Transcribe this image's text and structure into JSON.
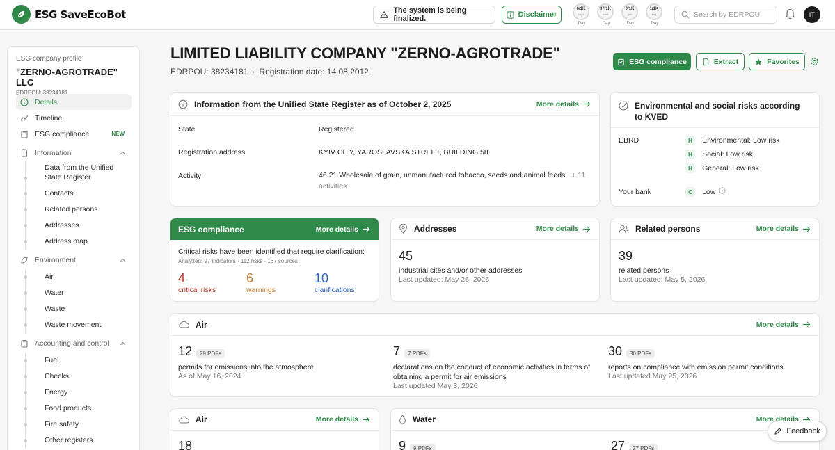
{
  "header": {
    "brand": "ESG SaveEcoBot",
    "system_notice": "The system is being finalized.",
    "disclaimer": "Disclaimer",
    "quotas": [
      {
        "value": "6/1K",
        "sub": "high",
        "label": "Day"
      },
      {
        "value": "37/1K",
        "sub": "med",
        "label": "Day"
      },
      {
        "value": "0/1K",
        "sub": "gen",
        "label": "Day"
      },
      {
        "value": "1/1K",
        "sub": "esg",
        "label": "Day"
      }
    ],
    "search_placeholder": "Search by EDRPOU",
    "avatar_initials": "IT"
  },
  "sidebar": {
    "caption": "ESG company profile",
    "company": "\"ZERNO-AGROTRADE\" LLC",
    "edrpou": "EDRPOU:  38234181",
    "details": "Details",
    "timeline": "Timeline",
    "esg": "ESG compliance",
    "new_badge": "NEW",
    "information": "Information",
    "info_items": [
      "Data from the Unified State Register",
      "Contacts",
      "Related persons",
      "Addresses",
      "Address map"
    ],
    "environment": "Environment",
    "env_items": [
      "Air",
      "Water",
      "Waste",
      "Waste movement"
    ],
    "accounting": "Accounting and control",
    "acc_items": [
      "Fuel",
      "Checks",
      "Energy",
      "Food products",
      "Fire safety",
      "Other registers"
    ]
  },
  "company": {
    "title": "LIMITED LIABILITY COMPANY \"ZERNO-AGROTRADE\"",
    "edrpou": "EDRPOU: 38234181",
    "sep": "·",
    "reg_date": "Registration date: 14.08.2012"
  },
  "actions": {
    "esg": "ESG compliance",
    "extract": "Extract",
    "favorites": "Favorites"
  },
  "register": {
    "title": "Information from the Unified State Register as of October 2, 2025",
    "more": "More details",
    "state_label": "State",
    "state_value": "Registered",
    "address_label": "Registration address",
    "address_value": "KYIV CITY, YAROSLAVSKA STREET, BUILDING 58",
    "activity_label": "Activity",
    "activity_value": "46.21 Wholesale of grain, unmanufactured tobacco, seeds and animal feeds",
    "activity_more": "+ 11 activities"
  },
  "risks": {
    "title": "Environmental and social risks according to KVED",
    "ebrd_label": "EBRD",
    "ebrd": [
      {
        "badge": "H",
        "text": "Environmental: Low risk"
      },
      {
        "badge": "H",
        "text": "Social: Low risk"
      },
      {
        "badge": "H",
        "text": "General: Low risk"
      }
    ],
    "bank_label": "Your bank",
    "bank_badge": "C",
    "bank_value": "Low"
  },
  "esg_card": {
    "title": "ESG compliance",
    "more": "More details",
    "headline": "Critical risks have been identified that require clarification:",
    "analyzed": "Analyzed: 97 indicators · 112 risks · 167 sources",
    "critical_value": "4",
    "critical_label": "critical risks",
    "warnings_value": "6",
    "warnings_label": "warnings",
    "clarif_value": "10",
    "clarif_label": "clarifications",
    "colors": {
      "critical": "#c0392b",
      "warning": "#c77a2a",
      "clarification": "#2a62c9"
    }
  },
  "addresses_card": {
    "title": "Addresses",
    "more": "More details",
    "value": "45",
    "text": "industrial sites and/or other addresses",
    "updated": "Last updated: May 26, 2026"
  },
  "persons_card": {
    "title": "Related persons",
    "more": "More details",
    "value": "39",
    "text": "related persons",
    "updated": "Last updated: May 5, 2026"
  },
  "air_card": {
    "title": "Air",
    "more": "More details",
    "stats": [
      {
        "value": "12",
        "pill": "29 PDFs",
        "text": "permits for emissions into the atmosphere",
        "date": "As of May 16, 2024"
      },
      {
        "value": "7",
        "pill": "7 PDFs",
        "text": "declarations on the conduct of economic activities in terms of obtaining a permit for air emissions",
        "date": "Last updated May 3, 2026"
      },
      {
        "value": "30",
        "pill": "30 PDFs",
        "text": "reports on compliance with emission permit conditions",
        "date": "Last updated May 25, 2026"
      }
    ]
  },
  "air_card2": {
    "title": "Air",
    "more": "More details",
    "value": "18"
  },
  "water_card": {
    "title": "Water",
    "more": "More details",
    "v1": "9",
    "p1": "9 PDFs",
    "v2": "27",
    "p2": "27 PDFs"
  },
  "feedback": "Feedback",
  "accent": "#2f8a4a"
}
